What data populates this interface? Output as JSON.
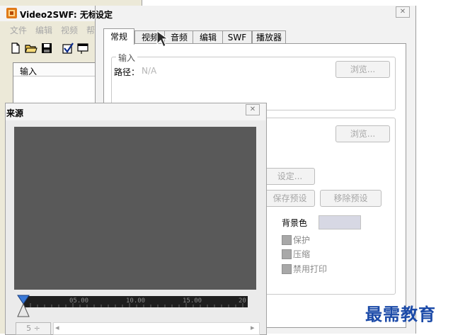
{
  "main_window": {
    "title": "Video2SWF: 无标题",
    "menu": [
      "文件",
      "编辑",
      "视频",
      "帮"
    ],
    "list_header": "输入"
  },
  "settings_dialog": {
    "title": "设定",
    "close_label": "✕",
    "tabs": [
      "常规",
      "视频",
      "音频",
      "编辑",
      "SWF",
      "播放器"
    ],
    "active_tab": "常规",
    "input_group": {
      "legend": "输入",
      "path_label": "路径：",
      "path_value": "N/A",
      "browse_label": "浏览..."
    },
    "output_group": {
      "browse_label": "浏览...",
      "setting_button": "设定...",
      "save_preset": "保存预设",
      "delete_preset": "移除预设",
      "bg_color_label": "背景色",
      "bg_color_value": "#d7d8e4",
      "checkboxes": [
        "保护",
        "压缩",
        "禁用打印"
      ]
    }
  },
  "source_window": {
    "title": "来源",
    "close_label": "✕",
    "timeline_ticks": [
      "05.00",
      "10.00",
      "15.00",
      "20"
    ],
    "step_button": "5 ÷",
    "scroll_arrow_left": "◂",
    "scroll_arrow_right": "▸"
  },
  "watermark": "最需教育",
  "colors": {
    "preview_bg": "#595959",
    "watermark": "#1b4aa8",
    "title_strip": "#1e6bd6"
  }
}
